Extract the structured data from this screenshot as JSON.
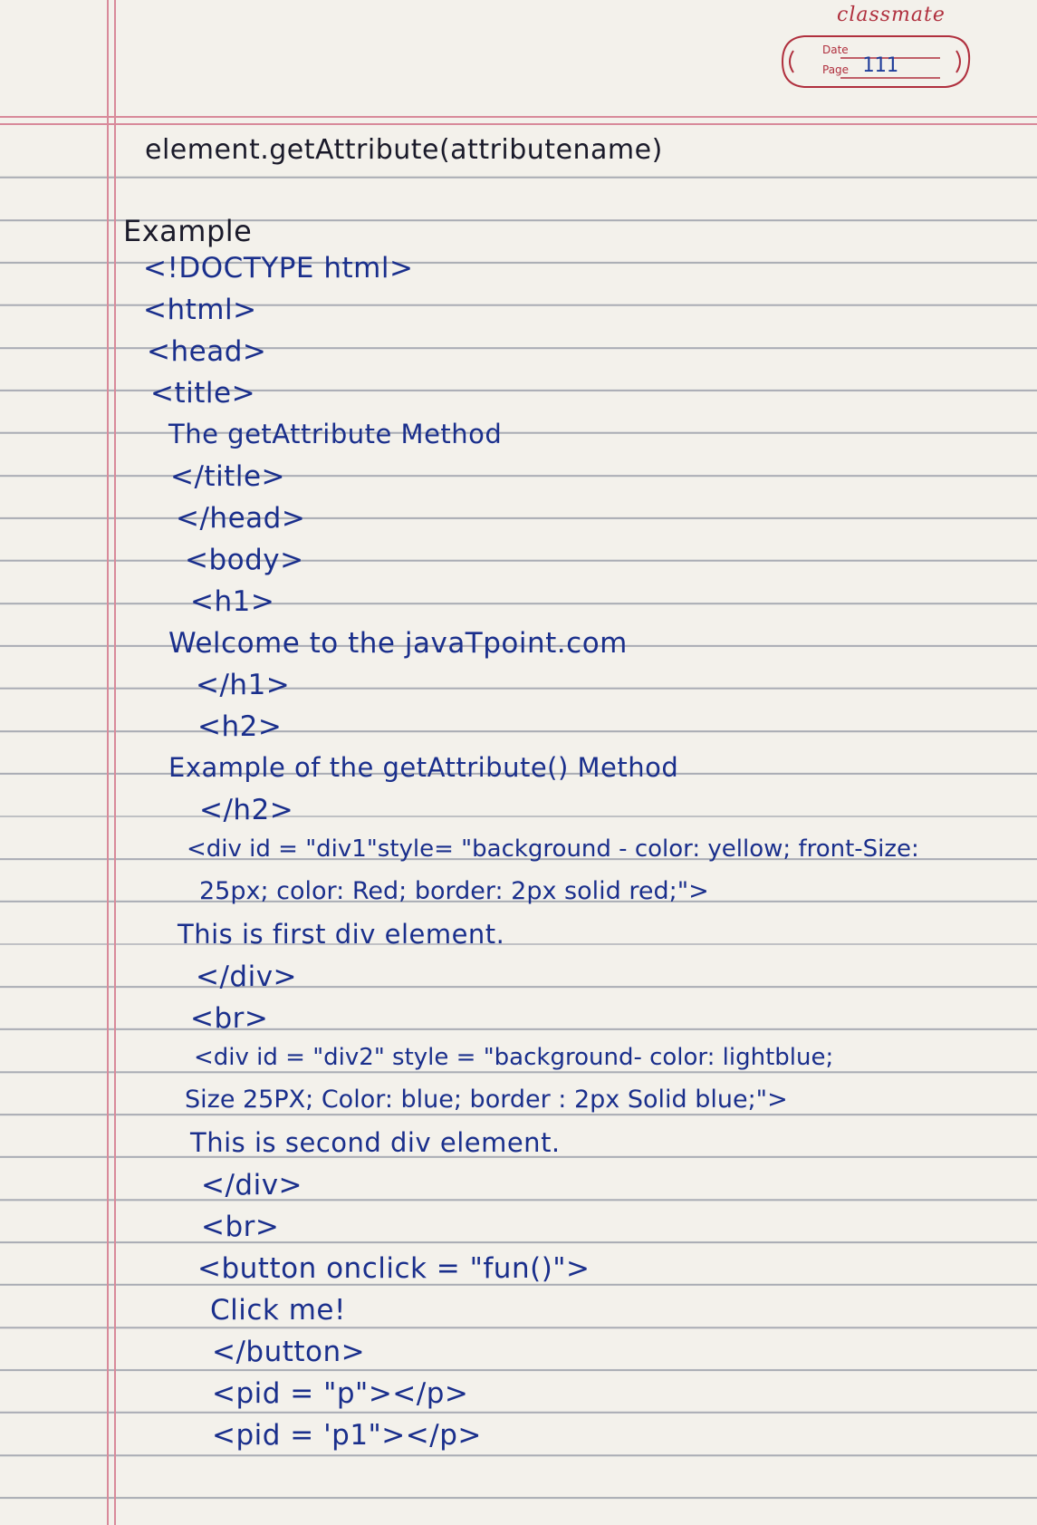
{
  "header": {
    "brand": "classmate",
    "date_label": "Date",
    "page_label": "Page",
    "page_number": "111"
  },
  "content": {
    "syntax": "element.getAttribute(attributename)",
    "example_heading": "Example",
    "lines": [
      "<!DOCTYPE html>",
      "<html>",
      "<head>",
      "<title>",
      "The getAttribute Method",
      "</title>",
      "</head>",
      "<body>",
      "<h1>",
      "Welcome to the javaTpoint.com",
      "</h1>",
      "<h2>",
      "Example of the getAttribute() Method",
      "</h2>",
      "<div id = \"div1\"style= \"background - color: yellow; front-Size:",
      "25px; color: Red; border: 2px solid red;\">",
      "This is first div element.",
      "</div>",
      "<br>",
      "<div id = \"div2\" style = \"background- color: lightblue;",
      "Size 25PX; Color: blue; border : 2px Solid blue;\">",
      "This is second div element.",
      "</div>",
      "<br>",
      "<button onclick = \"fun()\">",
      "Click me!",
      "</button>",
      "<pid = \"p\"></p>",
      "<pid = 'p1\"></p>"
    ]
  },
  "colors": {
    "ink_blue": "#1a2f8c",
    "ink_black": "#1a1a2a",
    "margin_red": "#d88a9a",
    "rule_gray": "#a9acb4",
    "paper": "#f3f1eb"
  }
}
